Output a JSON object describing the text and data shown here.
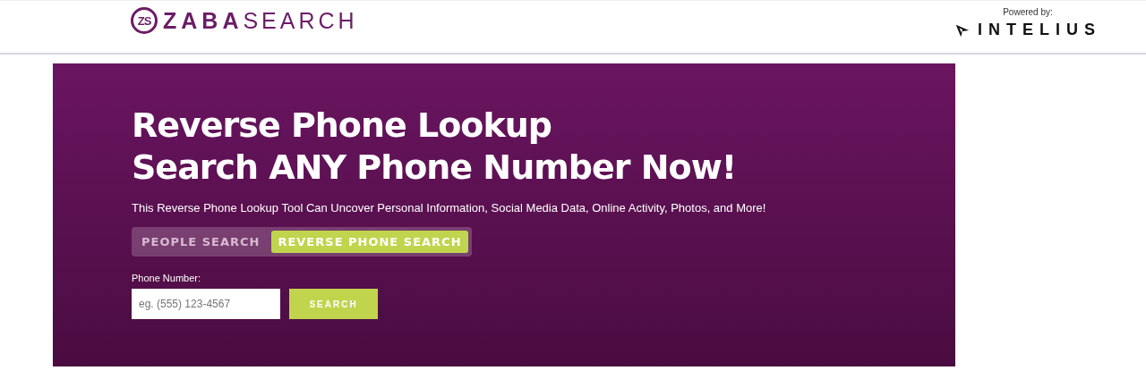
{
  "header": {
    "logo_mark": "ZS",
    "logo": "**ZABA**SEARCH",
    "powered_by": "Powered by:",
    "partner": "INTELIUS"
  },
  "hero": {
    "title_lines": [
      "Reverse Phone Lookup",
      "Search ANY Phone Number Now!"
    ],
    "subtitle": "This Reverse Phone Lookup Tool Can Uncover Personal Information, Social Media Data, Online Activity, Photos, and More!",
    "tabs": [
      {
        "label": "PEOPLE SEARCH",
        "selected": false
      },
      {
        "label": "REVERSE PHONE SEARCH",
        "selected": true
      }
    ],
    "field_label": "Phone Number:",
    "placeholder": "eg. (555) 123-4567",
    "button": "SEARCH"
  }
}
